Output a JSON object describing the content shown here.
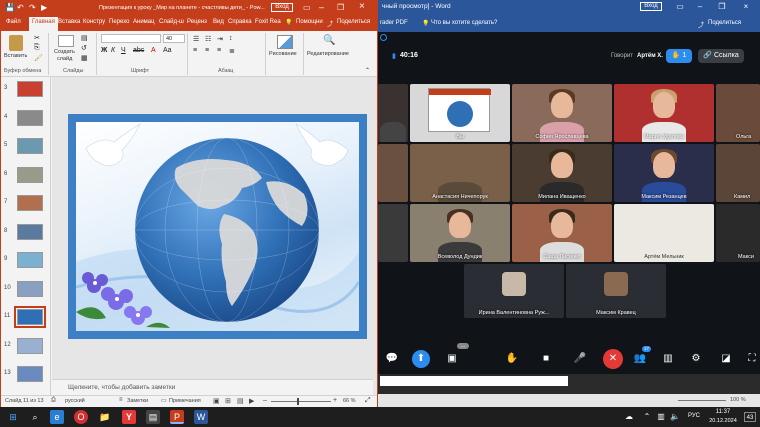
{
  "powerpoint": {
    "title": "Презентация к уроку _Мир на планете - счастливы дети_ - Pow...",
    "signin": "Вход",
    "tabs": [
      "Файл",
      "Главная",
      "Вставка",
      "Констру",
      "Перехо",
      "Анимац",
      "Слайд-ш",
      "Реценз",
      "Вид",
      "Справка",
      "Foxit Rea"
    ],
    "help_label": "Помощни",
    "share_label": "Поделиться",
    "ribbon": {
      "paste": "Вставить",
      "create_slide_1": "Создать",
      "create_slide_2": "слайд",
      "font_size": "40",
      "drawing": "Рисование",
      "editing": "Редактирование",
      "groups": [
        "Буфер обмена",
        "Слайды",
        "Шрифт",
        "Абзац"
      ]
    },
    "thumbnails": [
      "3",
      "4",
      "5",
      "6",
      "7",
      "8",
      "9",
      "10",
      "11",
      "12",
      "13"
    ],
    "selected_slide": "11",
    "notes_placeholder": "Щелкните, чтобы добавить заметки",
    "status": {
      "slide": "Слайд 11 из 13",
      "language": "русский",
      "notes": "Заметки",
      "comments": "Примечания",
      "zoom": "66 %"
    }
  },
  "word": {
    "title_fragment": "чный просмотр] - Word",
    "signin": "Вход",
    "ribbon_fragment": "rader PDF",
    "tell_me": "Что вы хотите сделать?",
    "share": "Поделиться"
  },
  "meeting": {
    "timer": "40:16",
    "speaking_label": "Говорит",
    "speaker": "Артём Х.",
    "hand_count": "1",
    "link_button": "Ссылка",
    "tiles": [
      {
        "name": ""
      },
      {
        "name": "Вы"
      },
      {
        "name": "София Ярославцева"
      },
      {
        "name": "Мария Удалова"
      },
      {
        "name": "Ольга"
      },
      {
        "name": "Анастасия Ничепорук"
      },
      {
        "name": "Милана Иващенко"
      },
      {
        "name": "Максим Резанцев"
      },
      {
        "name": "Камил"
      },
      {
        "name": "Всеволод Дундик"
      },
      {
        "name": "Саша Лисенко"
      },
      {
        "name": "Артём Мельник"
      },
      {
        "name": "Макси"
      },
      {
        "name": "Ирина Валентиновна Руж..."
      },
      {
        "name": "Максим Кравец"
      }
    ],
    "participants_count": "17",
    "more_badge": "..."
  },
  "word_status": {
    "zoom": "100 %"
  },
  "taskbar": {
    "language": "РУС",
    "time": "11:37",
    "date": "20.12.2024",
    "notification_count": "43"
  },
  "colors": {
    "ppt_brand": "#c43e1c",
    "word_brand": "#2b579a",
    "meeting_bg": "#101418",
    "accent_blue": "#2d8cf0",
    "end_call": "#e53935"
  }
}
